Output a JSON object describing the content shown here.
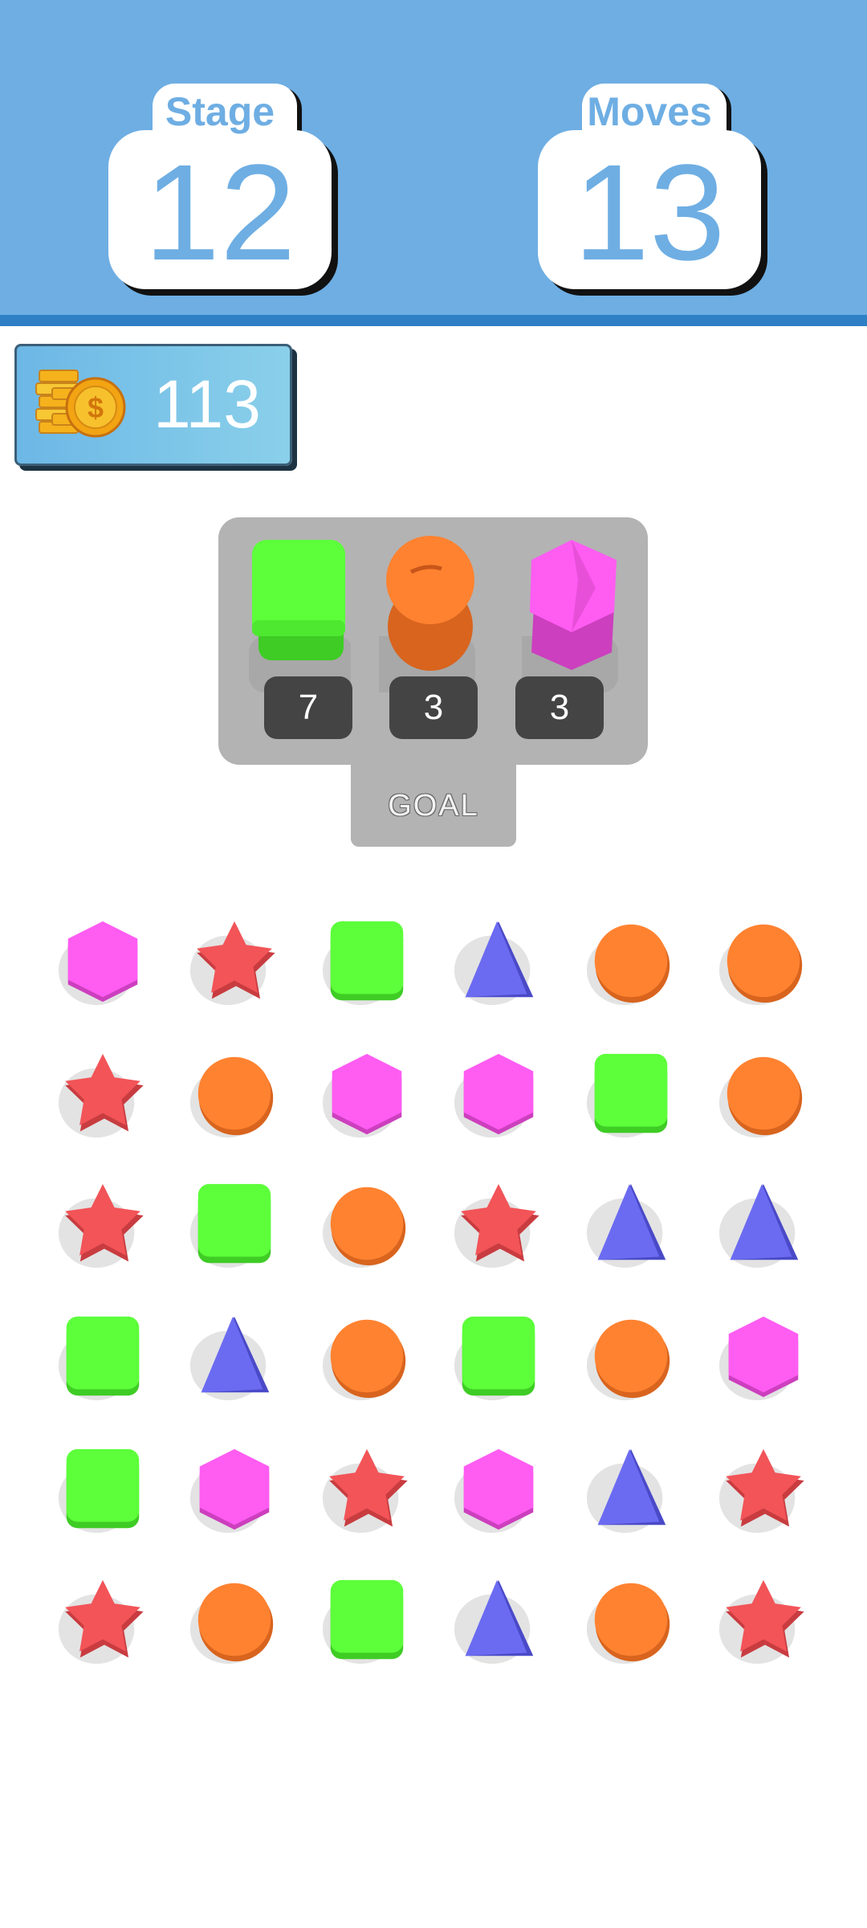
{
  "stage": {
    "label": "Stage",
    "value": "12"
  },
  "moves": {
    "label": "Moves",
    "value": "13"
  },
  "coins": {
    "count": "113",
    "icon": "coin-stack-icon"
  },
  "goal": {
    "tab_label": "GOAL",
    "items": [
      {
        "shape": "square",
        "count": "7"
      },
      {
        "shape": "circle",
        "count": "3"
      },
      {
        "shape": "hexagon",
        "count": "3"
      }
    ]
  },
  "colors": {
    "header": "#6eaee3",
    "square": "#5cff3a",
    "circle": "#ff8230",
    "hexagon": "#ff5cf2",
    "triangle": "#6b6bf2",
    "star": "#f25458"
  },
  "board": {
    "rows": [
      [
        "hexagon",
        "star",
        "square",
        "triangle",
        "circle",
        "circle"
      ],
      [
        "star",
        "circle",
        "hexagon",
        "hexagon",
        "square",
        "circle"
      ],
      [
        "star",
        "square",
        "circle",
        "star",
        "triangle",
        "triangle"
      ],
      [
        "square",
        "triangle",
        "circle",
        "square",
        "circle",
        "hexagon"
      ],
      [
        "square",
        "hexagon",
        "star",
        "hexagon",
        "triangle",
        "star"
      ],
      [
        "star",
        "circle",
        "square",
        "triangle",
        "circle",
        "star"
      ]
    ]
  }
}
